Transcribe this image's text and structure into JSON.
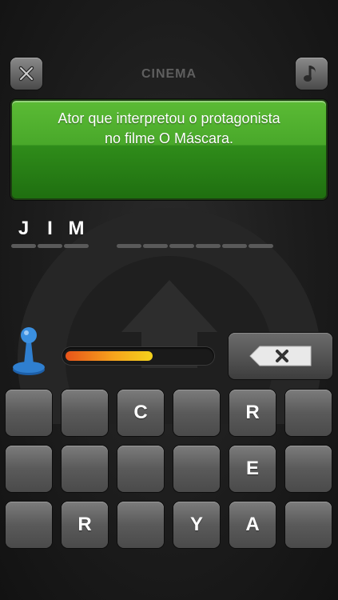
{
  "header": {
    "category": "CINEMA",
    "close_icon": "close-icon",
    "music_icon": "music-note-icon"
  },
  "clue": {
    "line1": "Ator que interpretou o protagonista",
    "line2": "no filme O Máscara."
  },
  "answer": {
    "slots": [
      "J",
      "I",
      "M",
      "",
      "",
      "",
      "",
      "",
      "",
      ""
    ]
  },
  "progress": {
    "fraction": 0.6
  },
  "delete_icon": "backspace-x-icon",
  "keyboard": {
    "rows": [
      [
        "",
        "",
        "C",
        "",
        "R",
        ""
      ],
      [
        "",
        "",
        "",
        "",
        "E",
        ""
      ],
      [
        "",
        "R",
        "",
        "Y",
        "A",
        ""
      ]
    ]
  },
  "colors": {
    "clue_green": "#3e9e22",
    "progress_start": "#e8541a",
    "progress_end": "#f4d21c",
    "pawn_blue": "#2f7fd0"
  }
}
